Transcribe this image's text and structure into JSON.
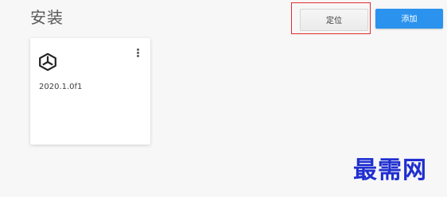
{
  "header": {
    "title": "安装"
  },
  "toolbar": {
    "locate_label": "定位",
    "add_label": "添加"
  },
  "installs": [
    {
      "version": "2020.1.0f1",
      "icon": "unity-logo-icon"
    }
  ],
  "watermark": {
    "text": "最需网"
  },
  "colors": {
    "accent": "#2b93ee",
    "highlight_box": "#e22d2d",
    "watermark": "#1f2fd0"
  }
}
